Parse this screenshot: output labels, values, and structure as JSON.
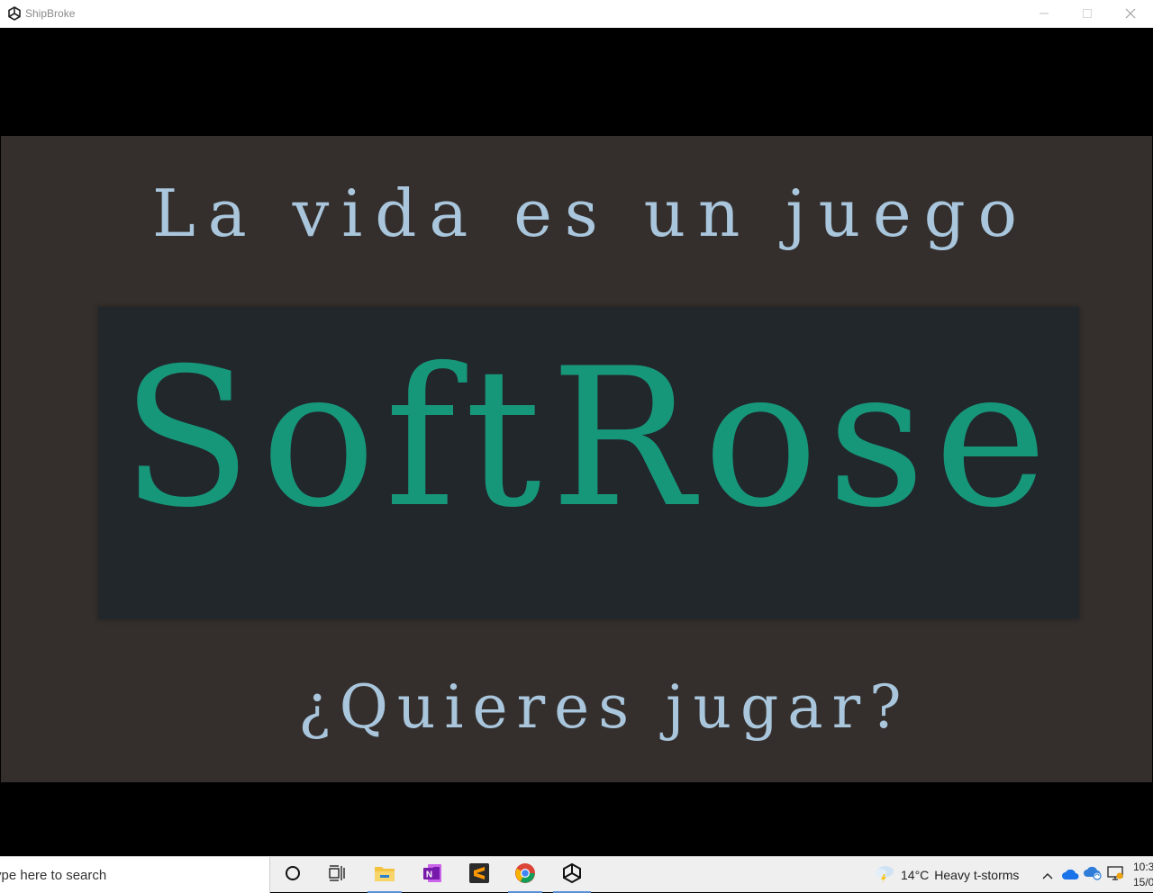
{
  "window": {
    "title": "ShipBroke",
    "icon": "unity-icon",
    "controls": [
      "minimize-icon",
      "maximize-icon",
      "close-icon"
    ]
  },
  "game_screen": {
    "headline": "La vida es un juego",
    "logo": "SoftRose",
    "question": "¿Quieres jugar?",
    "colors": {
      "background": "#342f2c",
      "logo_box": "#22272c",
      "logo_text": "#17977a",
      "caption_text": "#a9c6dd"
    }
  },
  "taskbar": {
    "search_placeholder": "ype here to search",
    "apps": [
      {
        "name": "cortana",
        "icon": "circle-icon"
      },
      {
        "name": "task-view",
        "icon": "task-view-icon"
      },
      {
        "name": "file-explorer",
        "icon": "folder-icon"
      },
      {
        "name": "onenote",
        "icon": "onenote-icon"
      },
      {
        "name": "sublime-text",
        "icon": "sublime-icon"
      },
      {
        "name": "chrome",
        "icon": "chrome-icon"
      },
      {
        "name": "unity",
        "icon": "unity-icon"
      }
    ],
    "weather": {
      "temperature": "14°C",
      "condition": "Heavy t-storms"
    },
    "clock": {
      "time": "10:3",
      "date": "15/0"
    }
  }
}
